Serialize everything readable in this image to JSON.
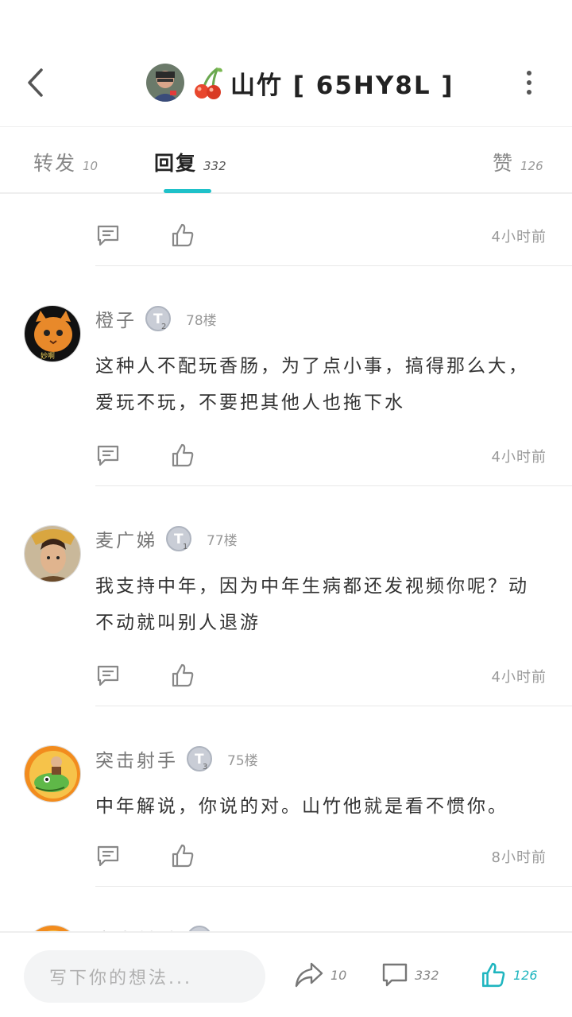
{
  "header": {
    "title": "山竹 [ 65HY8L ]",
    "accent_color": "#1fc1c9"
  },
  "tabs": [
    {
      "label": "转发",
      "count": "10"
    },
    {
      "label": "回复",
      "count": "332",
      "active": true
    },
    {
      "label": "赞",
      "count": "126"
    }
  ],
  "top_item": {
    "time": "4小时前"
  },
  "comments": [
    {
      "name": "橙子",
      "badge": "2",
      "floor": "78楼",
      "text": "这种人不配玩香肠，为了点小事，搞得那么大，爱玩不玩，不要把其他人也拖下水",
      "time": "4小时前"
    },
    {
      "name": "麦广娣",
      "badge": "1",
      "floor": "77楼",
      "text": "我支持中年，因为中年生病都还发视频你呢？动不动就叫别人退游",
      "time": "4小时前"
    },
    {
      "name": "突击射手",
      "badge": "3",
      "floor": "75楼",
      "text": "中年解说，你说的对。山竹他就是看不惯你。",
      "time": "8小时前"
    },
    {
      "name": "突击射手",
      "badge": "",
      "floor": "",
      "text": "",
      "time": ""
    }
  ],
  "bottom_bar": {
    "placeholder": "写下你的想法...",
    "share_count": "10",
    "comment_count": "332",
    "like_count": "126"
  },
  "icons": [
    "back-arrow-icon",
    "cherry-icon",
    "more-icon",
    "comment-icon",
    "like-icon",
    "share-icon",
    "level-badge-icon"
  ]
}
